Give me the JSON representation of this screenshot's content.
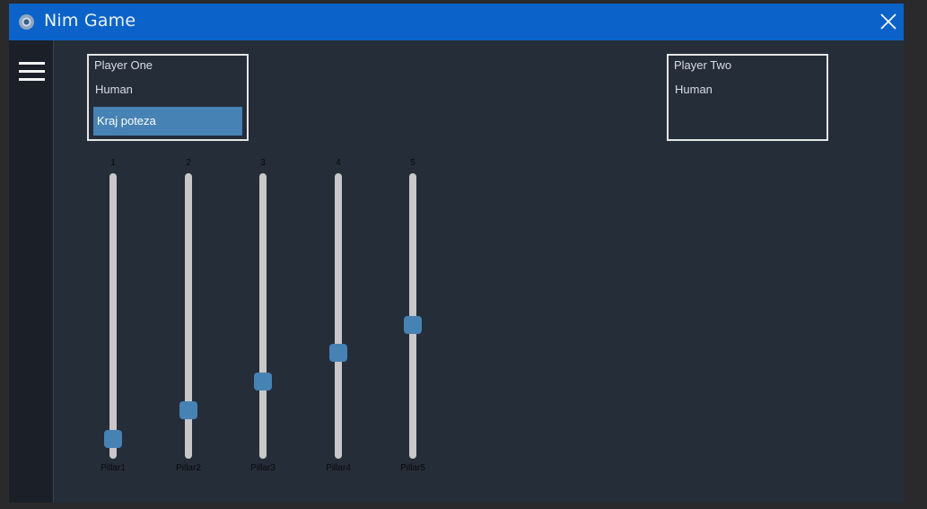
{
  "window": {
    "title": "Nim Game",
    "app_icon": "nim-app-icon",
    "close_icon": "close-icon",
    "menu_icon": "hamburger-menu-icon"
  },
  "players": {
    "one": {
      "name": "Player One",
      "type": "Human",
      "end_turn_label": "Kraj poteza"
    },
    "two": {
      "name": "Player Two",
      "type": "Human"
    }
  },
  "pillars": [
    {
      "number": "1",
      "label": "Pillar1",
      "level": 0.07
    },
    {
      "number": "2",
      "label": "Pillar2",
      "level": 0.17
    },
    {
      "number": "3",
      "label": "Pillar3",
      "level": 0.27
    },
    {
      "number": "4",
      "label": "Pillar4",
      "level": 0.37
    },
    {
      "number": "5",
      "label": "Pillar5",
      "level": 0.47
    }
  ],
  "colors": {
    "titlebar": "#0b63c9",
    "background": "#252d39",
    "sidebar": "#1b2028",
    "accent": "#4682b4",
    "track": "#c8c8c8"
  }
}
